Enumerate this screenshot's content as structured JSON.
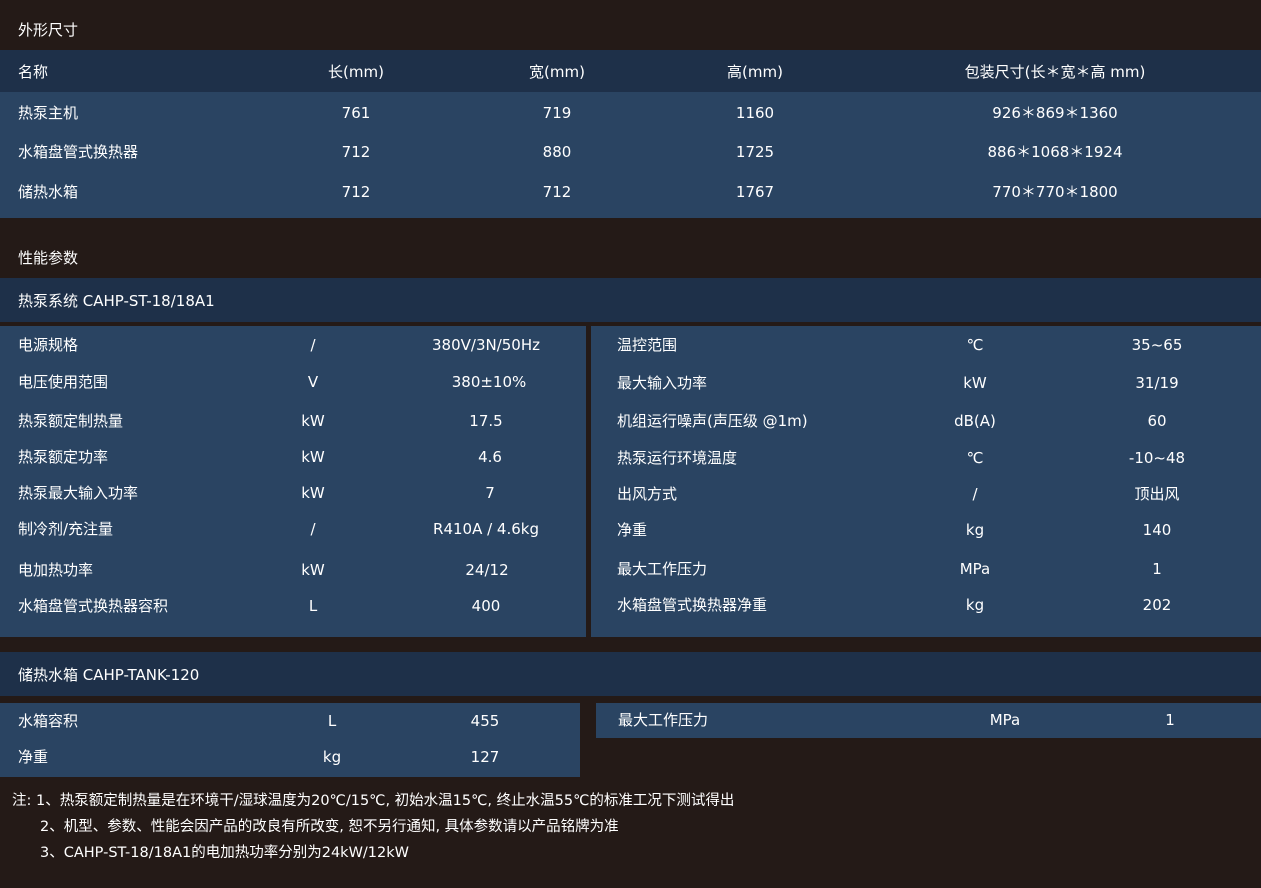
{
  "dimensions": {
    "title": "外形尺寸",
    "headers": [
      "名称",
      "长(mm)",
      "宽(mm)",
      "高(mm)",
      "包装尺寸(长＊宽＊高 mm)"
    ],
    "rows": [
      [
        "热泵主机",
        "761",
        "719",
        "1160",
        "926＊869＊1360"
      ],
      [
        "水箱盘管式换热器",
        "712",
        "880",
        "1725",
        "886＊1068＊1924"
      ],
      [
        "储热水箱",
        "712",
        "712",
        "1767",
        "770＊770＊1800"
      ]
    ]
  },
  "performance": {
    "title": "性能参数",
    "heatpump": {
      "title": "热泵系统 CAHP-ST-18/18A1",
      "left": [
        [
          "电源规格",
          "/",
          "380V/3N/50Hz"
        ],
        [
          "电压使用范围",
          "V",
          "380±10%"
        ],
        [
          "热泵额定制热量",
          "kW",
          "17.5"
        ],
        [
          "热泵额定功率",
          "kW",
          "4.6"
        ],
        [
          "热泵最大输入功率",
          "kW",
          "7"
        ],
        [
          "制冷剂/充注量",
          "/",
          "R410A / 4.6kg"
        ],
        [
          "电加热功率",
          "kW",
          "24/12"
        ],
        [
          "水箱盘管式换热器容积",
          "L",
          "400"
        ]
      ],
      "right": [
        [
          "温控范围",
          "℃",
          "35~65"
        ],
        [
          "最大输入功率",
          "kW",
          "31/19"
        ],
        [
          "机组运行噪声(声压级 @1m)",
          "dB(A)",
          "60"
        ],
        [
          "热泵运行环境温度",
          "℃",
          "-10~48"
        ],
        [
          "出风方式",
          "/",
          "顶出风"
        ],
        [
          "净重",
          "kg",
          "140"
        ],
        [
          "最大工作压力",
          "MPa",
          "1"
        ],
        [
          "水箱盘管式换热器净重",
          "kg",
          "202"
        ]
      ]
    },
    "tank": {
      "title": "储热水箱 CAHP-TANK-120",
      "left": [
        [
          "水箱容积",
          "L",
          "455"
        ],
        [
          "净重",
          "kg",
          "127"
        ]
      ],
      "right": [
        [
          "最大工作压力",
          "MPa",
          "1"
        ]
      ]
    }
  },
  "notes": [
    "注: 1、热泵额定制热量是在环境干/湿球温度为20℃/15℃, 初始水温15℃, 终止水温55℃的标准工况下测试得出",
    "2、机型、参数、性能会因产品的改良有所改变, 恕不另行通知, 具体参数请以产品铭牌为准",
    "3、CAHP-ST-18/18A1的电加热功率分别为24kW/12kW"
  ],
  "colors": {
    "background": "#241a17",
    "header_bar": "#1e3049",
    "panel": "#2a4462",
    "text": "#ffffff"
  }
}
